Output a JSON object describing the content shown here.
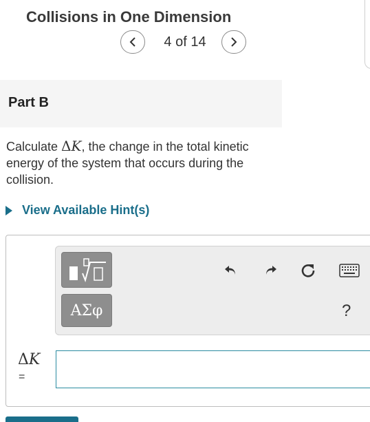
{
  "header": {
    "title": "Collisions in One Dimension"
  },
  "pager": {
    "count": "4 of 14"
  },
  "part": {
    "label": "Part B"
  },
  "question": {
    "prefix": "Calculate ",
    "math_delta": "Δ",
    "math_var": "K",
    "suffix": ", the change in the total kinetic energy of the system that occurs during the collision."
  },
  "hint": {
    "label": "View Available Hint(s)"
  },
  "toolbar": {
    "greek_label": "ΑΣφ",
    "help_label": "?"
  },
  "answer": {
    "label_delta": "Δ",
    "label_var": "K",
    "equals": "=",
    "value": ""
  },
  "colors": {
    "accent": "#1a6e8a",
    "input_border": "#2a8ba0",
    "tool_button": "#8e8e8e"
  },
  "icons": [
    "chevron-left-icon",
    "chevron-right-icon",
    "templates-icon",
    "undo-icon",
    "redo-icon",
    "reset-icon",
    "keyboard-icon"
  ]
}
